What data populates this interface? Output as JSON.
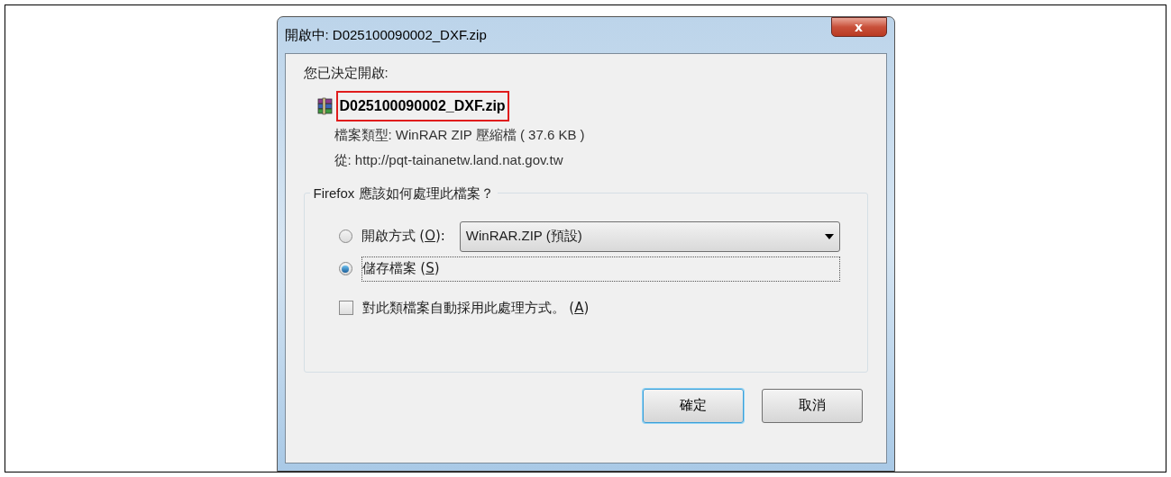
{
  "window": {
    "title": "開啟中: D025100090002_DXF.zip",
    "close_label": "x"
  },
  "intro": "您已決定開啟:",
  "file": {
    "name": "D025100090002_DXF.zip",
    "highlighted": true,
    "type_line": "檔案類型: WinRAR ZIP 壓縮檔 ( 37.6 KB )",
    "from_line": "從: http://pqt-tainanetw.land.nat.gov.tw"
  },
  "group": {
    "legend": "Firefox 應該如何處理此檔案？",
    "options": [
      {
        "kind": "open_with",
        "before": "開啟方式 (",
        "key": "O",
        "after": "):",
        "selected": false,
        "dropdown": "WinRAR.ZIP (預設)"
      },
      {
        "kind": "save",
        "before": "儲存檔案 (",
        "key": "S",
        "after": ")",
        "selected": true,
        "focused": true
      }
    ],
    "checkbox": {
      "before": "對此類檔案自動採用此處理方式。 (",
      "key": "A",
      "after": ")",
      "checked": false
    }
  },
  "buttons": [
    {
      "label": "確定",
      "default": true
    },
    {
      "label": "取消",
      "default": false
    }
  ]
}
